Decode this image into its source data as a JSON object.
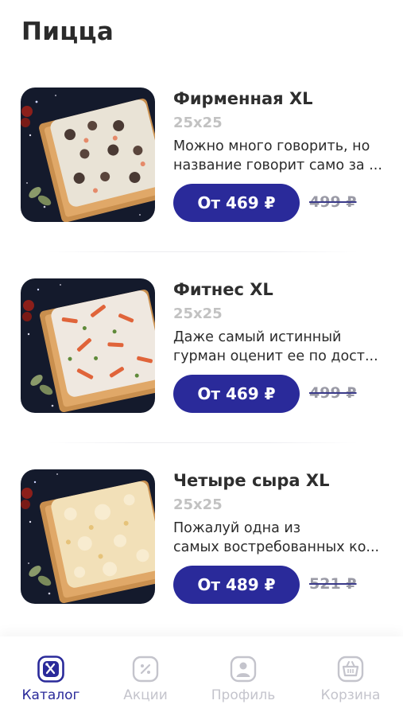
{
  "header": {
    "title": "Пицца"
  },
  "products": [
    {
      "name": "Фирменная XL",
      "size": "25x25",
      "desc_line1": "Можно много говорить, но",
      "desc_line2": "название говорит само за ...",
      "price": "От 469 ₽",
      "old_price": "499 ₽",
      "topping": "mushroom"
    },
    {
      "name": "Фитнес XL",
      "size": "25x25",
      "desc_line1": "Даже самый истинный",
      "desc_line2": "гурман оценит ее по дост...",
      "price": "От 469 ₽",
      "old_price": "499 ₽",
      "topping": "veggie"
    },
    {
      "name": "Четыре сыра XL",
      "size": "25x25",
      "desc_line1": "Пожалуй одна из",
      "desc_line2": "самых востребованных ко...",
      "price": "От 489 ₽",
      "old_price": "521 ₽",
      "topping": "cheese"
    }
  ],
  "tabbar": {
    "items": [
      {
        "label": "Каталог",
        "icon": "fork-knife-icon",
        "active": true
      },
      {
        "label": "Акции",
        "icon": "percent-tag-icon",
        "active": false
      },
      {
        "label": "Профиль",
        "icon": "user-icon",
        "active": false
      },
      {
        "label": "Корзина",
        "icon": "basket-icon",
        "active": false
      }
    ]
  },
  "colors": {
    "accent": "#2a2a9a",
    "tab_inactive": "#c4c4cc",
    "old_price": "#9a9aa6"
  }
}
